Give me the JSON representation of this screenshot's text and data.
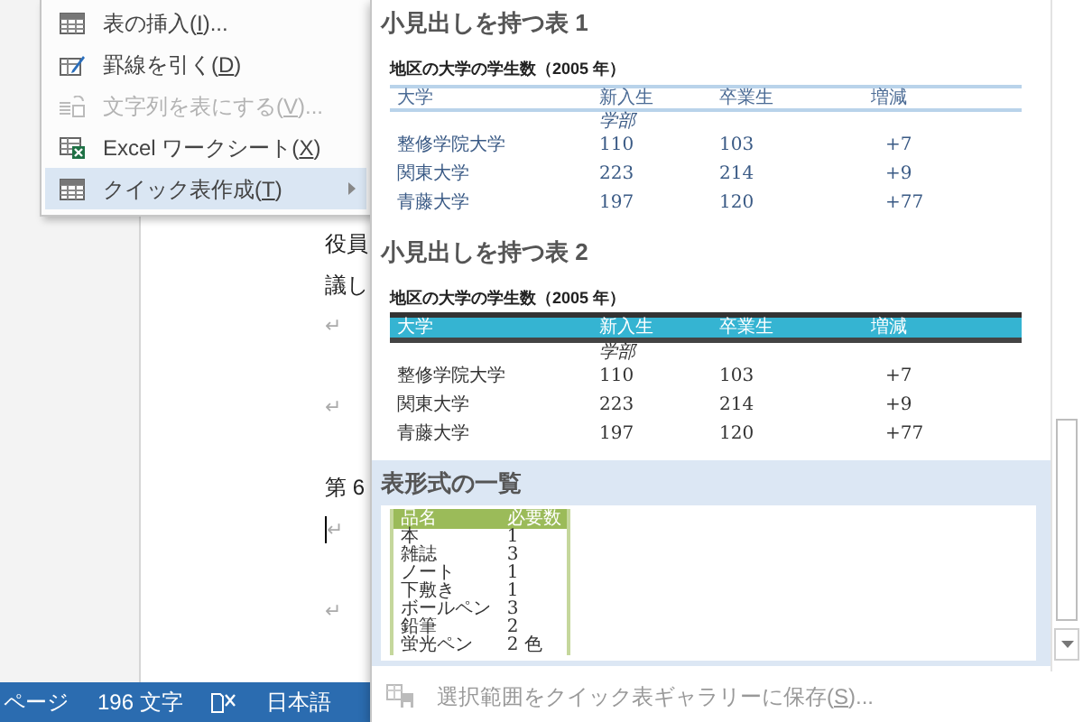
{
  "menu": {
    "items": [
      {
        "label": "表の挿入(",
        "access_key": "I",
        "suffix": ")...",
        "disabled": false,
        "selected": false,
        "submenu": false
      },
      {
        "label": "罫線を引く(",
        "access_key": "D",
        "suffix": ")",
        "disabled": false,
        "selected": false,
        "submenu": false
      },
      {
        "label": "文字列を表にする(",
        "access_key": "V",
        "suffix": ")...",
        "disabled": true,
        "selected": false,
        "submenu": false
      },
      {
        "label": "Excel ワークシート(",
        "access_key": "X",
        "suffix": ")",
        "disabled": false,
        "selected": false,
        "submenu": false
      },
      {
        "label": "クイック表作成(",
        "access_key": "T",
        "suffix": ")",
        "disabled": false,
        "selected": true,
        "submenu": true
      }
    ]
  },
  "document": {
    "lines": [
      {
        "kind": "text",
        "text": "役員"
      },
      {
        "kind": "text",
        "text": "議し"
      },
      {
        "kind": "mark",
        "text": "↵"
      },
      {
        "kind": "blank"
      },
      {
        "kind": "mark",
        "text": "↵"
      },
      {
        "kind": "blank"
      },
      {
        "kind": "text",
        "text": "第 6"
      },
      {
        "kind": "cursor",
        "text": "↵"
      },
      {
        "kind": "blank"
      },
      {
        "kind": "mark",
        "text": "↵"
      }
    ]
  },
  "gallery": {
    "sections": [
      {
        "title": "小見出しを持つ表 1",
        "selected": false,
        "table": {
          "caption": "地区の大学の学生数（2005 年）",
          "columns": [
            "大学",
            "新入生",
            "卒業生",
            "増減"
          ],
          "subheading": "学部",
          "rows": [
            [
              "整修学院大学",
              "110",
              "103",
              "+7"
            ],
            [
              "関東大学",
              "223",
              "214",
              "+9"
            ],
            [
              "青藤大学",
              "197",
              "120",
              "+77"
            ]
          ]
        }
      },
      {
        "title": "小見出しを持つ表 2",
        "selected": false,
        "table": {
          "caption": "地区の大学の学生数（2005 年）",
          "columns": [
            "大学",
            "新入生",
            "卒業生",
            "増減"
          ],
          "subheading": "学部",
          "rows": [
            [
              "整修学院大学",
              "110",
              "103",
              "+7"
            ],
            [
              "関東大学",
              "223",
              "214",
              "+9"
            ],
            [
              "青藤大学",
              "197",
              "120",
              "+77"
            ]
          ]
        }
      },
      {
        "title": "表形式の一覧",
        "selected": true,
        "table": {
          "columns": [
            "品名",
            "必要数"
          ],
          "rows": [
            [
              "本",
              "1"
            ],
            [
              "雑誌",
              "3"
            ],
            [
              "ノート",
              "1"
            ],
            [
              "下敷き",
              "1"
            ],
            [
              "ボールペン",
              "3"
            ],
            [
              "鉛筆",
              "2"
            ],
            [
              "蛍光ペン",
              "2 色"
            ]
          ]
        }
      }
    ],
    "save": {
      "label": "選択範囲をクイック表ギャラリーに保存(",
      "access_key": "S",
      "suffix": ")...",
      "disabled": true
    }
  },
  "status_bar": {
    "items": [
      {
        "kind": "text",
        "text": "ページ"
      },
      {
        "kind": "text",
        "text": "196 文字"
      },
      {
        "kind": "icon"
      },
      {
        "kind": "text",
        "text": "日本語"
      }
    ]
  }
}
